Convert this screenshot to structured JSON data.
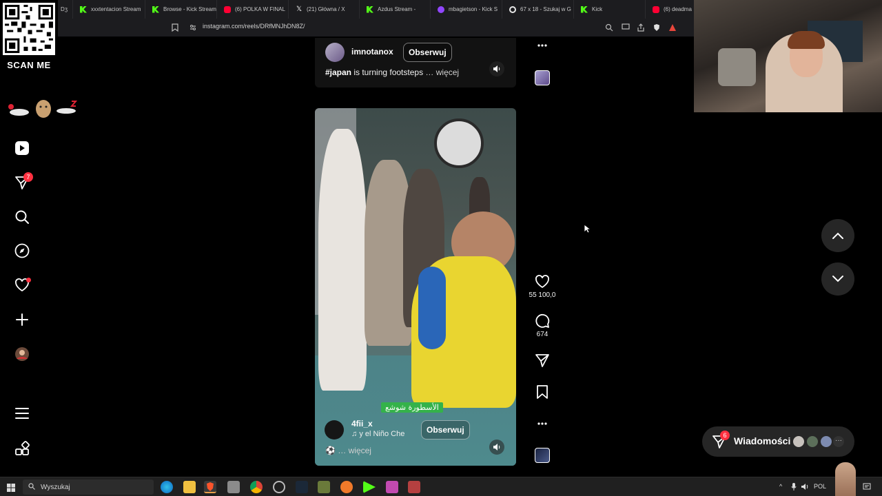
{
  "browser": {
    "tabs": [
      {
        "title": "Dʒ",
        "icon": "blank"
      },
      {
        "title": "xxxtentacion Stream",
        "icon": "kick"
      },
      {
        "title": "Browse - Kick Stream",
        "icon": "kick"
      },
      {
        "title": "(6) POLKA W FINAL",
        "icon": "youtube"
      },
      {
        "title": "(21) Główna / X",
        "icon": "x"
      },
      {
        "title": "Azdus Stream -",
        "icon": "kick"
      },
      {
        "title": "mbagietson - Kick S",
        "icon": "twitch"
      },
      {
        "title": "67 x 18 - Szukaj w G",
        "icon": "google"
      },
      {
        "title": "Kick",
        "icon": "kick"
      },
      {
        "title": "(6) deadma",
        "icon": "youtube"
      }
    ],
    "url": "instagram.com/reels/DRfMNJhDN8Z/"
  },
  "overlay": {
    "qr_label": "SCAN ME"
  },
  "sidebar": {
    "notifications_badge": "7"
  },
  "reels": {
    "top": {
      "username": "imnotanox",
      "follow_label": "Obserwuj",
      "caption_tag": "#japan",
      "caption_text": " is turning footsteps",
      "more_label": "… więcej"
    },
    "main": {
      "username": "4fii_x",
      "follow_label": "Obserwuj",
      "audio_text": "y el Niño   Che",
      "caption_more": "… więcej",
      "subtitle": "الأسطورة شوشع",
      "likes": "55 100,0",
      "comments": "674"
    }
  },
  "messages": {
    "label": "Wiadomości",
    "badge": "6"
  },
  "taskbar": {
    "search_placeholder": "Wyszukaj",
    "language": "POL"
  },
  "colors": {
    "accent_red": "#ff3040",
    "kick_green": "#53fc18",
    "background": "#000000"
  }
}
